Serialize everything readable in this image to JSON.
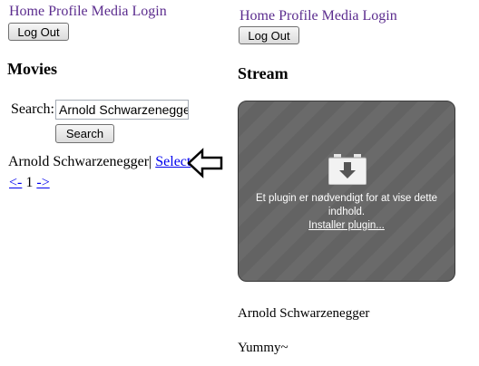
{
  "left": {
    "nav": [
      "Home",
      "Profile",
      "Media",
      "Login"
    ],
    "logout_label": "Log Out",
    "heading": "Movies",
    "search_label": "Search:",
    "search_value": "Arnold Schwarzenegger",
    "search_button": "Search",
    "result_name": "Arnold Schwarzenegger|",
    "select_link": "Select",
    "pager_prev": "<-",
    "pager_page": "1",
    "pager_next": "->"
  },
  "right": {
    "nav": [
      "Home",
      "Profile",
      "Media",
      "Login"
    ],
    "logout_label": "Log Out",
    "heading": "Stream",
    "plugin_message_line1": "Et plugin er nødvendigt for at vise dette",
    "plugin_message_line2": "indhold.",
    "plugin_install_link": "Installer plugin...",
    "title_text": "Arnold Schwarzenegger",
    "comment_text": "Yummy~"
  },
  "annotation": {
    "arrow_icon": "outline-left-arrow-icon"
  }
}
